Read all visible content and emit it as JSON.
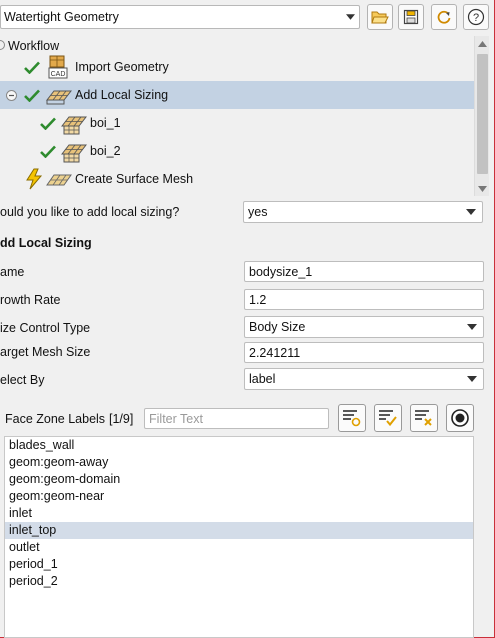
{
  "header": {
    "workflow_select": "Watertight Geometry",
    "buttons": [
      "open-folder-icon",
      "save-icon",
      "refresh-icon",
      "help-icon"
    ],
    "help_label": "?"
  },
  "tree": {
    "root": "Workflow",
    "items": [
      {
        "label": "Import Geometry",
        "status": "done"
      },
      {
        "label": "Add Local Sizing",
        "status": "done",
        "selected": true
      },
      {
        "label": "boi_1",
        "status": "done"
      },
      {
        "label": "boi_2",
        "status": "done"
      },
      {
        "label": "Create Surface Mesh",
        "status": "pending"
      }
    ]
  },
  "question": {
    "label": "ould you like to add local sizing?",
    "value": "yes"
  },
  "section_title": "dd Local Sizing",
  "form": {
    "name_label": "ame",
    "name_value": "bodysize_1",
    "growth_label": "rowth Rate",
    "growth_value": "1.2",
    "size_type_label": "ize Control Type",
    "size_type_value": "Body Size",
    "target_label": "arget Mesh Size",
    "target_value": "2.241211",
    "select_by_label": "elect By",
    "select_by_value": "label"
  },
  "face_zones": {
    "label": "Face Zone Labels",
    "count": "[1/9]",
    "filter_placeholder": "Filter Text",
    "items": [
      "blades_wall",
      "geom:geom-away",
      "geom:geom-domain",
      "geom:geom-near",
      "inlet",
      "inlet_top",
      "outlet",
      "period_1",
      "period_2"
    ],
    "selected_index": 5
  },
  "colors": {
    "check_green": "#2e8b2e",
    "selection_blue": "#c3d2e3",
    "list_selection": "#d3dce8",
    "pending_yellow": "#e6b400"
  }
}
